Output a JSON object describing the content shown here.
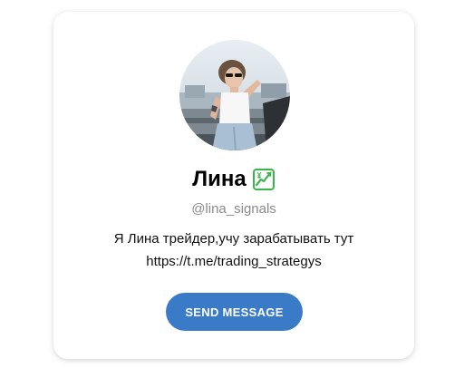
{
  "profile": {
    "name": "Лина",
    "name_emoji_icon": "chart-increasing-yen-icon",
    "username": "@lina_signals",
    "bio_line_1": "Я Лина трейдер,учу зарабатывать тут",
    "bio_line_2": "https://t.me/trading_strategys",
    "avatar_icon": "profile-photo"
  },
  "actions": {
    "send_message_label": "SEND MESSAGE"
  },
  "colors": {
    "button_bg": "#3a7bc8",
    "username_text": "#8a8a8a",
    "emoji_green": "#3bb54a"
  }
}
